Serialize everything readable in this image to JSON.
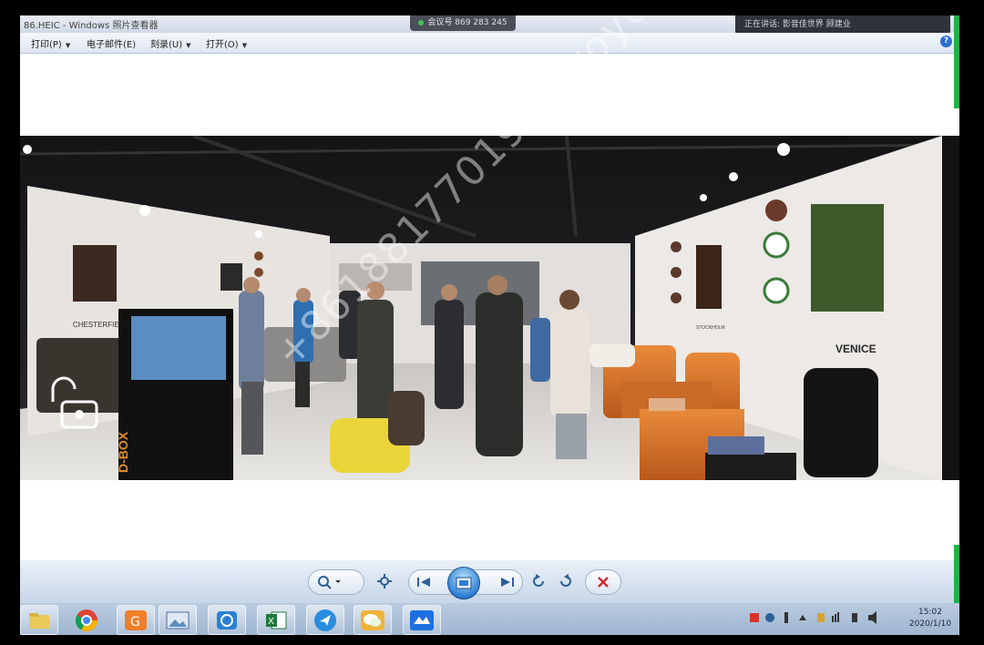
{
  "window": {
    "title": "86.HEIC - Windows 照片查看器",
    "meeting_banner": "会议号 869 283 245",
    "speaking_banner": "正在讲话: 影音佳世界 顾建业"
  },
  "menu": [
    {
      "label": "打印(P)"
    },
    {
      "label": "电子邮件(E)"
    },
    {
      "label": "刻录(U)"
    },
    {
      "label": "打开(O)"
    }
  ],
  "watermark": "+8618817701990 yoyo",
  "photo": {
    "brand_left": "CHESTERFIELD",
    "brand_right": "VENICE",
    "dbox_label": "D-BOX",
    "stockholm_label": "STOCKHOLM"
  },
  "toolbar": {
    "zoom_icon": "zoom-icon",
    "fit_icon": "actual-size-icon",
    "prev_icon": "previous-icon",
    "slideshow_icon": "slideshow-icon",
    "next_icon": "next-icon",
    "rotate_ccw_icon": "rotate-left-icon",
    "rotate_cw_icon": "rotate-right-icon",
    "delete_icon": "delete-icon"
  },
  "taskbar": {
    "apps": [
      "file-explorer",
      "chrome",
      "sogou",
      "photo-viewer",
      "network-app",
      "excel",
      "send-app",
      "wechat",
      "tencent-meeting"
    ],
    "time": "15:02",
    "date": "2020/1/10"
  },
  "colors": {
    "accent": "#2d7fd3",
    "delete": "#d62b2b",
    "green_bar": "#1fb24a"
  }
}
